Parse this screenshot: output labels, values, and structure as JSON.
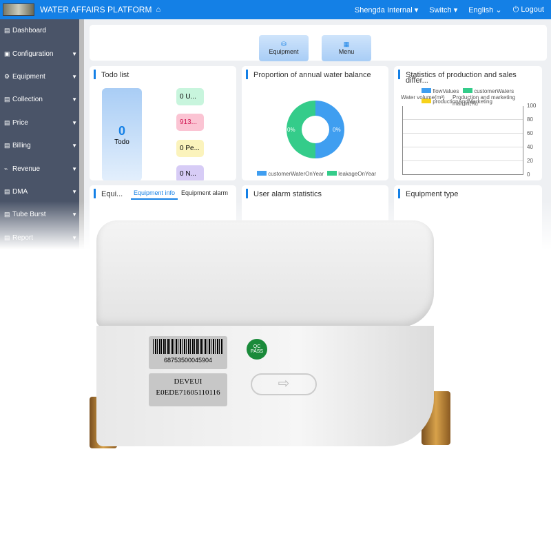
{
  "header": {
    "title": "WATER AFFAIRS PLATFORM",
    "org": "Shengda Internal ▾",
    "switch": "Switch ▾",
    "lang": "English ⌄",
    "logout": "Logout"
  },
  "sidebar": {
    "items": [
      {
        "label": "Dashboard",
        "icon": "▤"
      },
      {
        "label": "Configuration",
        "icon": "▣"
      },
      {
        "label": "Equipment",
        "icon": "⚙"
      },
      {
        "label": "Collection",
        "icon": "▤"
      },
      {
        "label": "Price",
        "icon": "▤"
      },
      {
        "label": "Billing",
        "icon": "▤"
      },
      {
        "label": "Revenue",
        "icon": "⌁"
      },
      {
        "label": "DMA",
        "icon": "▤"
      },
      {
        "label": "Tube Burst",
        "icon": "▤"
      },
      {
        "label": "Report",
        "icon": "▤"
      }
    ]
  },
  "quick": {
    "equipment": "Equipment",
    "menu": "Menu"
  },
  "todo": {
    "title": "Todo list",
    "count": "0",
    "label": "Todo",
    "pills": [
      "0 U...",
      "913...",
      "0 Pe...",
      "0 N..."
    ]
  },
  "balance": {
    "title": "Proportion of annual water balance",
    "left": "0%",
    "right": "0%",
    "legend": [
      "customerWaterOnYear",
      "leakageOnYear"
    ]
  },
  "stats": {
    "title": "Statistics of production and sales differ...",
    "legend": [
      "flowValues",
      "customerWaters",
      "productionAndMarketing"
    ],
    "ylabel_left": "Water volume(m³)",
    "ylabel_right": "Production and marketing margin(%)",
    "ticks": [
      "100",
      "80",
      "60",
      "40",
      "20",
      "0"
    ]
  },
  "equip": {
    "title": "Equi...",
    "tabs": [
      "Equipment info",
      "Equipment alarm"
    ]
  },
  "alarm": {
    "title": "User alarm statistics"
  },
  "etype": {
    "title": "Equipment type"
  },
  "meter": {
    "barcode": "68753500045904",
    "devlabel": "DEVEUI",
    "deveui": "E0EDE71605110116",
    "qc": "QC PASS"
  }
}
